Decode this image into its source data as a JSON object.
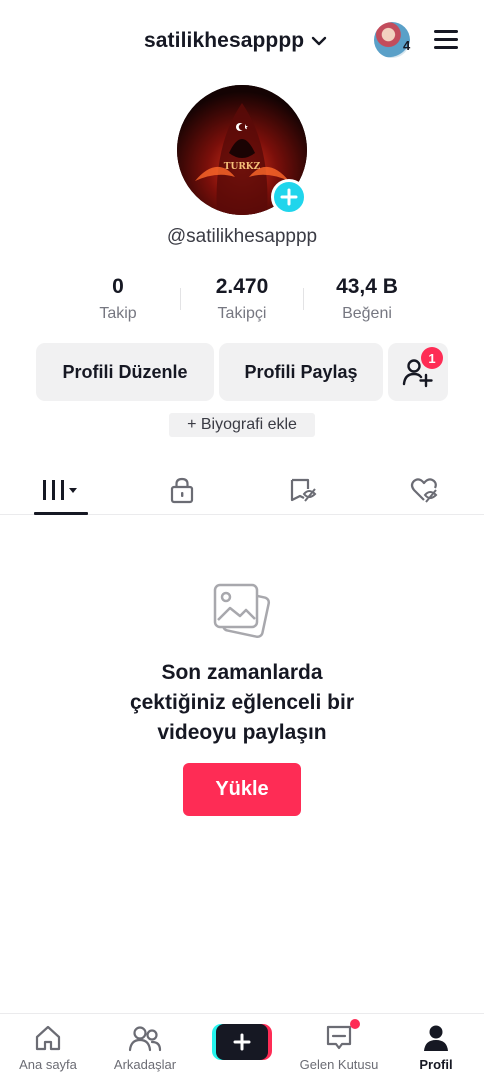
{
  "header": {
    "username": "satilikhesapppp",
    "story_count": "4"
  },
  "profile": {
    "handle": "@satilikhesapppp",
    "avatar_text": "TURKZ"
  },
  "stats": [
    {
      "value": "0",
      "label": "Takip"
    },
    {
      "value": "2.470",
      "label": "Takipçi"
    },
    {
      "value": "43,4 B",
      "label": "Beğeni"
    }
  ],
  "actions": {
    "edit_profile": "Profili Düzenle",
    "share_profile": "Profili Paylaş",
    "friend_badge": "1",
    "add_bio": "+ Biyografi ekle"
  },
  "tabs": [
    {
      "icon": "grid-icon",
      "active": true
    },
    {
      "icon": "lock-icon",
      "active": false
    },
    {
      "icon": "tagged-icon",
      "active": false
    },
    {
      "icon": "liked-icon",
      "active": false
    }
  ],
  "empty_state": {
    "message": "Son zamanlarda çektiğiniz eğlenceli bir videoyu paylaşın",
    "upload_label": "Yükle"
  },
  "bottom_nav": {
    "home": "Ana sayfa",
    "friends": "Arkadaşlar",
    "inbox": "Gelen Kutusu",
    "profile": "Profil"
  },
  "colors": {
    "accent": "#fe2c55",
    "cyan": "#25f4ee",
    "add_avatar": "#20d5ec",
    "text": "#161823"
  }
}
